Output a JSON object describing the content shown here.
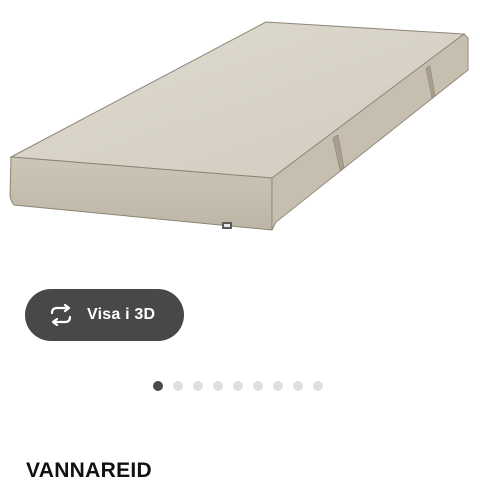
{
  "product": {
    "name": "VANNAREID",
    "image": {
      "subject": "mattress-image",
      "colors": {
        "top": "#d7d1c4",
        "side": "#c9c2b2",
        "edge": "#8c8476"
      }
    }
  },
  "view3d": {
    "label": "Visa i 3D",
    "icon": "rotate-3d-icon",
    "background": "#484848"
  },
  "carousel": {
    "total": 9,
    "active_index": 0,
    "active_color": "#4a4a4a",
    "inactive_color": "#dfdfdf"
  }
}
